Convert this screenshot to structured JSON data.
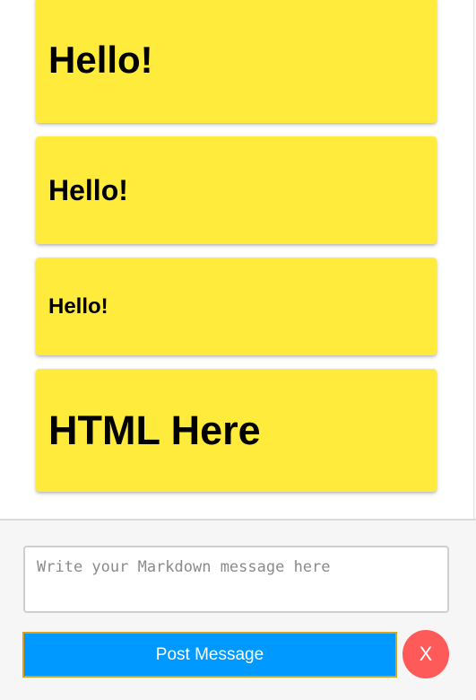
{
  "messages": [
    {
      "text": "Hello!"
    },
    {
      "text": "Hello!"
    },
    {
      "text": "Hello!"
    },
    {
      "text": "HTML Here"
    }
  ],
  "composer": {
    "placeholder": "Write your Markdown message here",
    "value": "",
    "post_label": "Post Message",
    "close_label": "X"
  },
  "colors": {
    "card_background": "#ffeb3b",
    "post_button": "#0099ff",
    "close_button": "#ff5a5a",
    "composer_background": "#f6f6f6"
  }
}
